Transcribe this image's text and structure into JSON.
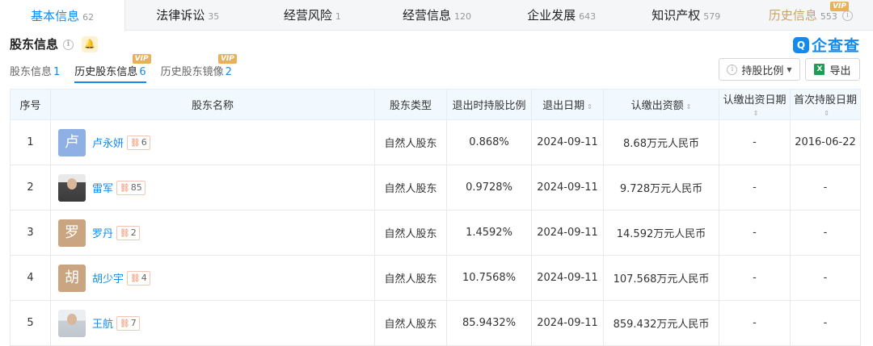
{
  "top_tabs": [
    {
      "label": "基本信息",
      "count": "62"
    },
    {
      "label": "法律诉讼",
      "count": "35"
    },
    {
      "label": "经营风险",
      "count": "1"
    },
    {
      "label": "经营信息",
      "count": "120"
    },
    {
      "label": "企业发展",
      "count": "643"
    },
    {
      "label": "知识产权",
      "count": "579"
    },
    {
      "label": "历史信息",
      "count": "553",
      "vip": "VIP"
    }
  ],
  "section": {
    "title": "股东信息"
  },
  "logo": {
    "text": "企查查",
    "icon_glyph": "Q"
  },
  "sub_tabs": [
    {
      "label": "股东信息",
      "count": "1"
    },
    {
      "label": "历史股东信息",
      "count": "6",
      "vip": "VIP"
    },
    {
      "label": "历史股东镜像",
      "count": "2",
      "vip": "VIP"
    }
  ],
  "buttons": {
    "ratio": "持股比例",
    "export": "导出",
    "excel_glyph": "X"
  },
  "table": {
    "headers": [
      "序号",
      "股东名称",
      "股东类型",
      "退出时持股比例",
      "退出日期",
      "认缴出资额",
      "认缴出资日期",
      "首次持股日期"
    ],
    "rows": [
      {
        "no": "1",
        "avatar_char": "卢",
        "avatar_color": "#8fb0e4",
        "name": "卢永妍",
        "rel": "6",
        "type": "自然人股东",
        "ratio": "0.868%",
        "exit_date": "2024-09-11",
        "amount": "8.68万元人民币",
        "sub_date": "-",
        "first_date": "2016-06-22"
      },
      {
        "no": "2",
        "avatar_char": "",
        "avatar_color": "photo",
        "name": "雷军",
        "rel": "85",
        "type": "自然人股东",
        "ratio": "0.9728%",
        "exit_date": "2024-09-11",
        "amount": "9.728万元人民币",
        "sub_date": "-",
        "first_date": "-"
      },
      {
        "no": "3",
        "avatar_char": "罗",
        "avatar_color": "#c9a581",
        "name": "罗丹",
        "rel": "2",
        "type": "自然人股东",
        "ratio": "1.4592%",
        "exit_date": "2024-09-11",
        "amount": "14.592万元人民币",
        "sub_date": "-",
        "first_date": "-"
      },
      {
        "no": "4",
        "avatar_char": "胡",
        "avatar_color": "#c9a581",
        "name": "胡少宇",
        "rel": "4",
        "type": "自然人股东",
        "ratio": "10.7568%",
        "exit_date": "2024-09-11",
        "amount": "107.568万元人民币",
        "sub_date": "-",
        "first_date": "-"
      },
      {
        "no": "5",
        "avatar_char": "",
        "avatar_color": "photo-light",
        "name": "王航",
        "rel": "7",
        "type": "自然人股东",
        "ratio": "85.9432%",
        "exit_date": "2024-09-11",
        "amount": "859.432万元人民币",
        "sub_date": "-",
        "first_date": "-"
      }
    ]
  },
  "colors": {
    "accent": "#128bed",
    "vip": "#e6b15a",
    "history_tab": "#c8a36a",
    "header_bg": "#f2f9fe"
  }
}
